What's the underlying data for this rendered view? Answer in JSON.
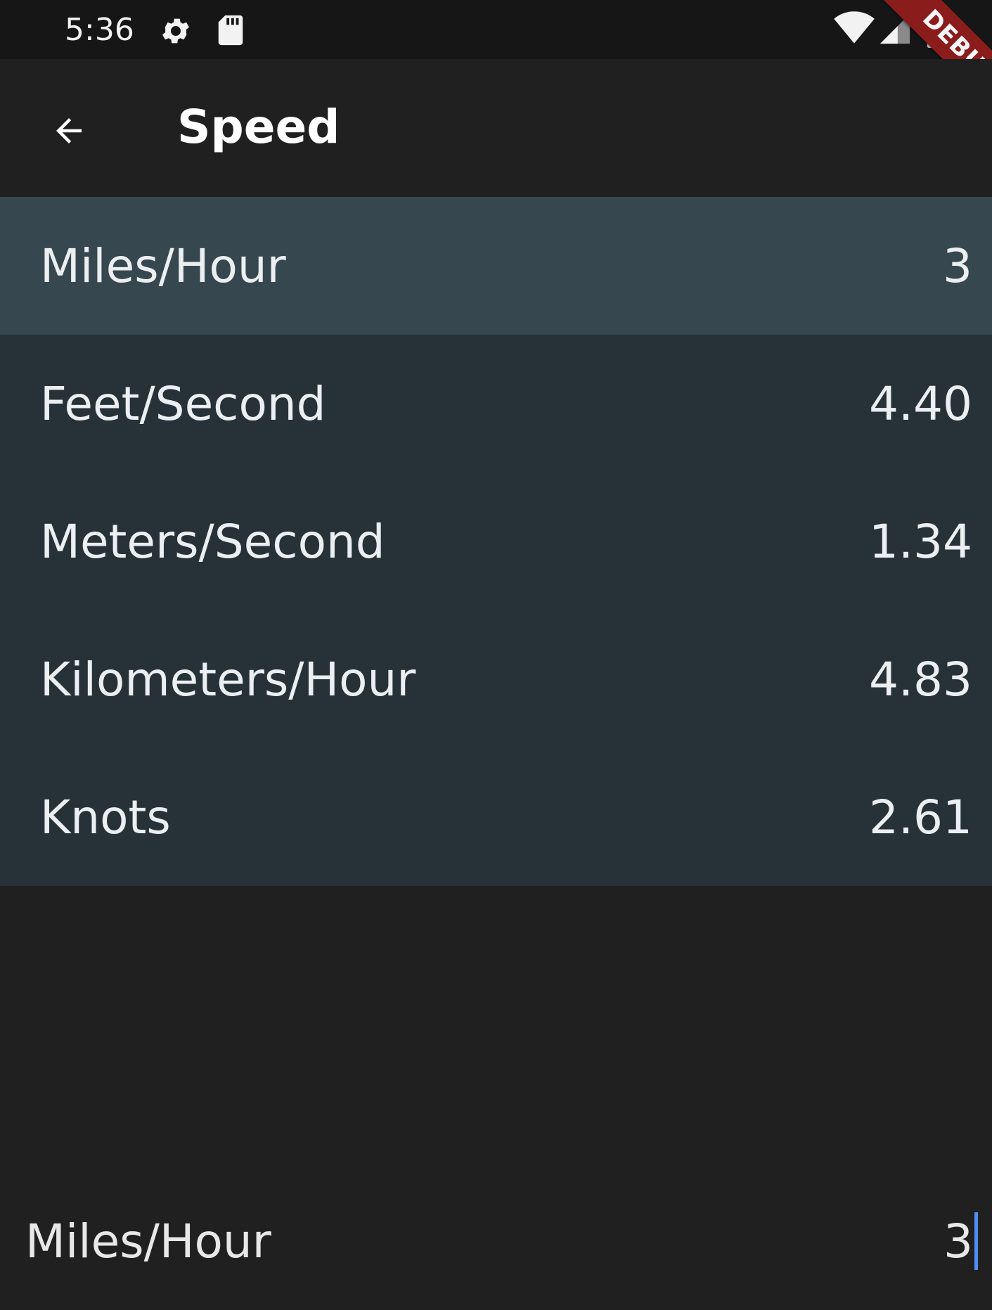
{
  "status_bar": {
    "time": "5:36",
    "icons": [
      "gear-icon",
      "sd-card-icon",
      "wifi-icon",
      "signal-icon",
      "battery-icon"
    ]
  },
  "debug_banner": "DEBUG",
  "app_bar": {
    "back_icon": "arrow-back-icon",
    "title": "Speed"
  },
  "units": [
    {
      "name": "Miles/Hour",
      "value": "3",
      "selected": true
    },
    {
      "name": "Feet/Second",
      "value": "4.40",
      "selected": false
    },
    {
      "name": "Meters/Second",
      "value": "1.34",
      "selected": false
    },
    {
      "name": "Kilometers/Hour",
      "value": "4.83",
      "selected": false
    },
    {
      "name": "Knots",
      "value": "2.61",
      "selected": false
    }
  ],
  "input": {
    "unit_label": "Miles/Hour",
    "value": "3"
  },
  "colors": {
    "background": "#202020",
    "list_background": "#263238",
    "selected_row": "#37474f",
    "caret": "#4f8ef7",
    "debug_banner": "#8a1c1c"
  }
}
